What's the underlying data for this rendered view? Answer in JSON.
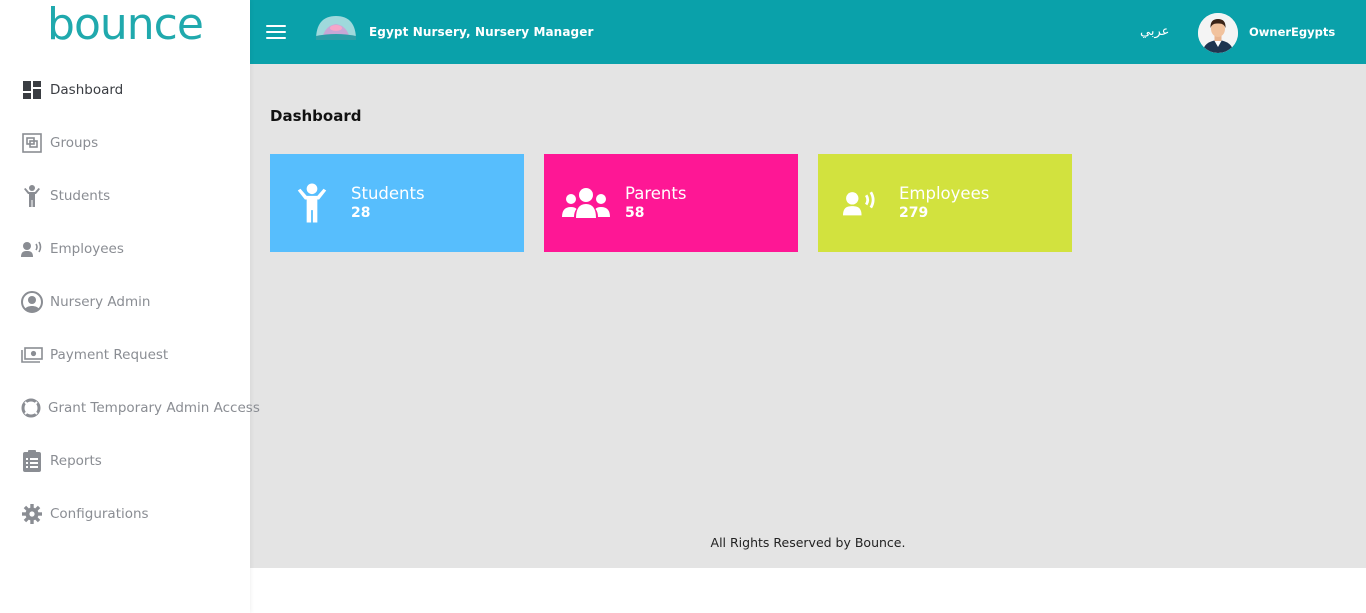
{
  "app": {
    "logo_text": "bounce"
  },
  "header": {
    "nursery_name": "Egypt Nursery, Nursery Manager",
    "language_toggle": "عربي",
    "username": "OwnerEgypts",
    "color": "#0aa1aa"
  },
  "sidebar": {
    "items": [
      {
        "label": "Dashboard",
        "icon": "dashboard-icon",
        "active": true
      },
      {
        "label": "Groups",
        "icon": "groups-icon"
      },
      {
        "label": "Students",
        "icon": "child-icon"
      },
      {
        "label": "Employees",
        "icon": "employee-icon"
      },
      {
        "label": "Nursery Admin",
        "icon": "user-circle-icon"
      },
      {
        "label": "Payment Request",
        "icon": "money-icon"
      },
      {
        "label": "Grant Temporary Admin Access",
        "icon": "lifebuoy-icon"
      },
      {
        "label": "Reports",
        "icon": "clipboard-icon"
      },
      {
        "label": "Configurations",
        "icon": "gear-icon"
      }
    ]
  },
  "main": {
    "title": "Dashboard",
    "cards": [
      {
        "title": "Students",
        "count": "28",
        "color": "#57befd",
        "icon": "child-icon"
      },
      {
        "title": "Parents",
        "count": "58",
        "color": "#fe1795",
        "icon": "users-icon"
      },
      {
        "title": "Employees",
        "count": "279",
        "color": "#d2e23e",
        "icon": "employee-icon"
      }
    ],
    "footer": "All Rights Reserved by Bounce."
  }
}
